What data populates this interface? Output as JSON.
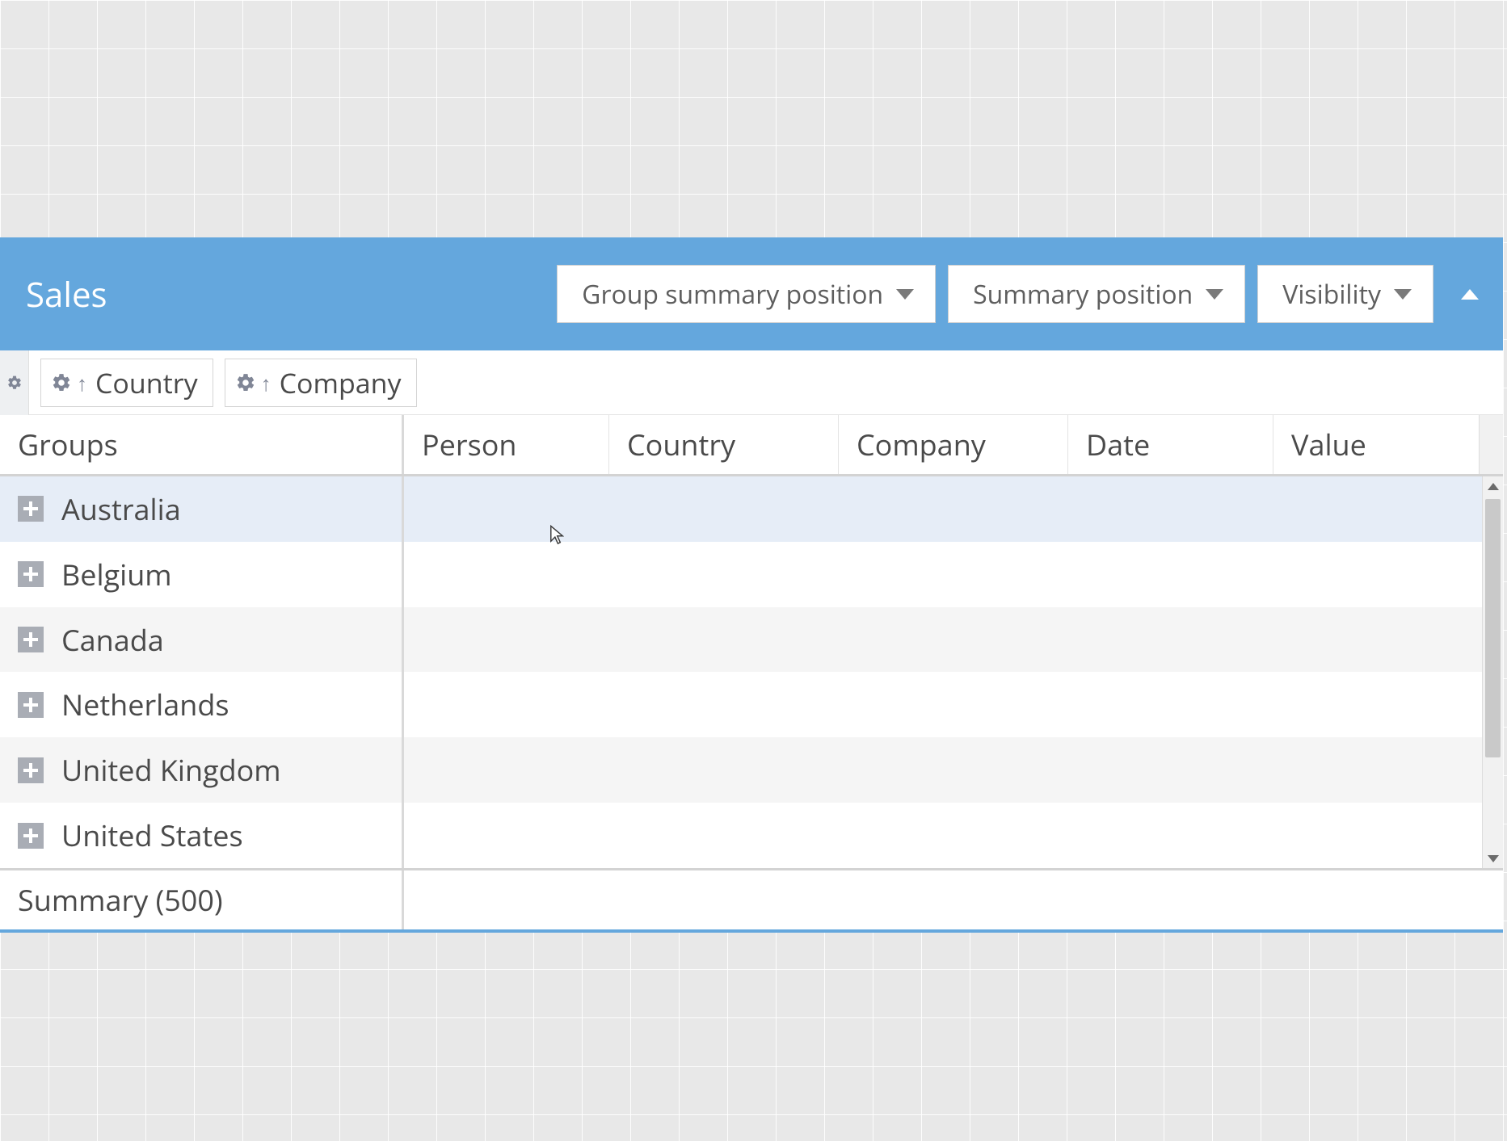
{
  "panel": {
    "title": "Sales",
    "dropdowns": [
      {
        "label": "Group summary position"
      },
      {
        "label": "Summary position"
      },
      {
        "label": "Visibility"
      }
    ]
  },
  "groupby": {
    "chips": [
      {
        "label": "Country"
      },
      {
        "label": "Company"
      }
    ]
  },
  "columns": {
    "groups": "Groups",
    "person": "Person",
    "country": "Country",
    "company": "Company",
    "date": "Date",
    "value": "Value"
  },
  "groups": [
    {
      "label": "Australia"
    },
    {
      "label": "Belgium"
    },
    {
      "label": "Canada"
    },
    {
      "label": "Netherlands"
    },
    {
      "label": "United Kingdom"
    },
    {
      "label": "United States"
    }
  ],
  "summary": {
    "label": "Summary (500)"
  }
}
